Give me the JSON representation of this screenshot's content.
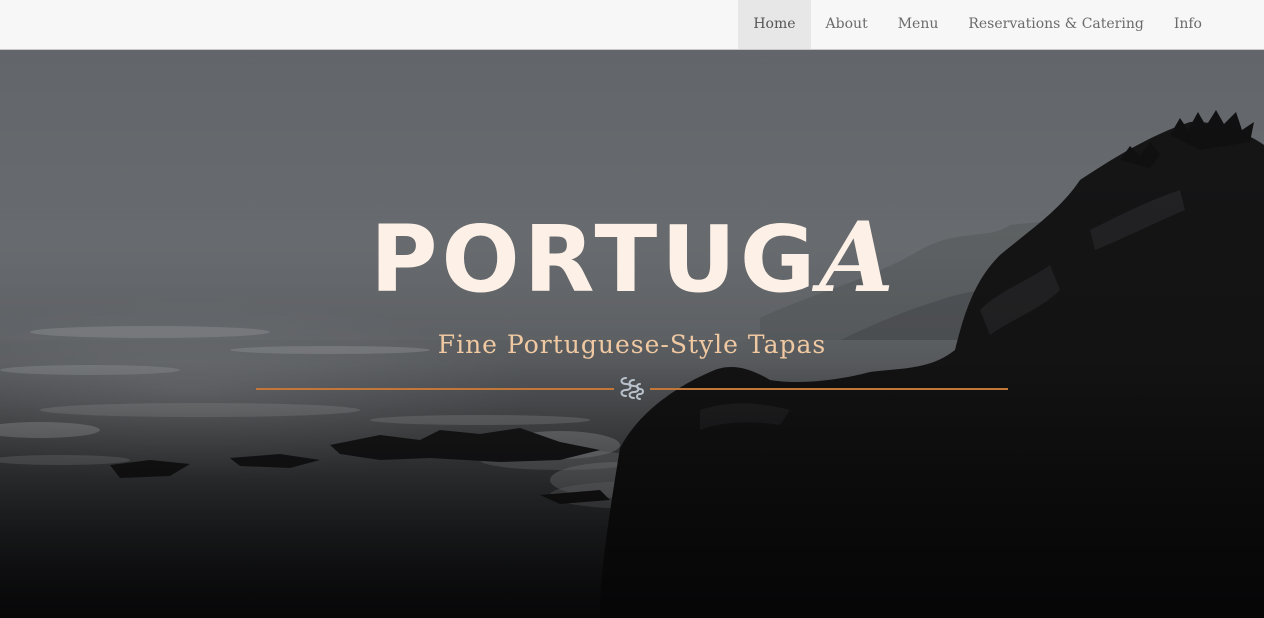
{
  "nav": {
    "items": [
      {
        "label": "Home",
        "active": true
      },
      {
        "label": "About",
        "active": false
      },
      {
        "label": "Menu",
        "active": false
      },
      {
        "label": "Reservations & Catering",
        "active": false
      },
      {
        "label": "Info",
        "active": false
      }
    ]
  },
  "hero": {
    "brand_main": "PORTUG",
    "brand_last": "A",
    "tagline": "Fine Portuguese-Style Tapas",
    "ornament_icon": "flourish-ornament-icon",
    "background": "stormy-coastline-photo"
  },
  "colors": {
    "nav_bg": "#f7f7f7",
    "nav_active_bg": "#e7e7e7",
    "brand_text": "#fdf1e7",
    "tagline_text": "#f0c9a2",
    "divider": "#c27637"
  }
}
